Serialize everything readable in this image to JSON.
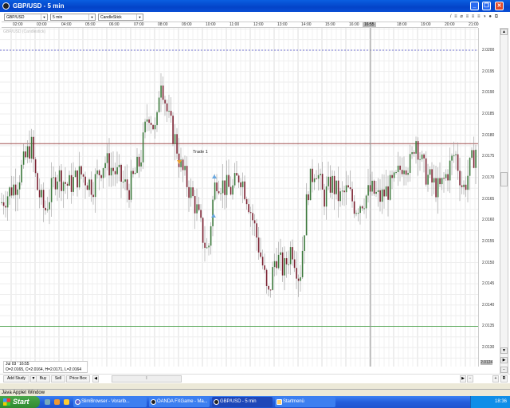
{
  "window": {
    "title": "GBP/USD - 5 min"
  },
  "toolbar": {
    "instrument": "GBP/USD",
    "interval": "5 min",
    "chart_type": "CandleStick",
    "tools": "/ ≡ ⌀  ≡ ≡ ≡ ◑ ● ⧉"
  },
  "time_axis": {
    "labels": [
      "02:00",
      "03:00",
      "04:00",
      "05:00",
      "06:00",
      "07:00",
      "08:00",
      "09:00",
      "10:00",
      "11:00",
      "12:00",
      "13:00",
      "14:00",
      "15:00",
      "16:00",
      "18:00",
      "19:00",
      "20:00",
      "21:00"
    ],
    "cursor_time": "16:55"
  },
  "chart_legend": "GBP/USD (Candlestick)",
  "price_axis": {
    "labels": [
      "2.0200",
      "2.0195",
      "2.0190",
      "2.0185",
      "2.0180",
      "2.0175",
      "2.0170",
      "2.0165",
      "2.0160",
      "2.0155",
      "2.0150",
      "2.0145",
      "2.0140",
      "2.0135",
      "2.0130"
    ],
    "current": "2.0124"
  },
  "annotations": {
    "trade_label": "Trade 1",
    "trade_line_price": 2.0178,
    "support_line_price": 2.0135,
    "dotted_line_price": 2.02
  },
  "chart_data": {
    "type": "candlestick",
    "ylim": [
      2.0121,
      2.0206
    ],
    "close_path": [
      [
        0,
        2.0164
      ],
      [
        20,
        2.0169
      ],
      [
        38,
        2.0178
      ],
      [
        45,
        2.0168
      ],
      [
        55,
        2.0162
      ],
      [
        70,
        2.0171
      ],
      [
        85,
        2.0168
      ],
      [
        100,
        2.0171
      ],
      [
        115,
        2.0168
      ],
      [
        130,
        2.0174
      ],
      [
        145,
        2.0171
      ],
      [
        160,
        2.0167
      ],
      [
        175,
        2.0174
      ],
      [
        185,
        2.0186
      ],
      [
        195,
        2.018
      ],
      [
        200,
        2.0195
      ],
      [
        210,
        2.0184
      ],
      [
        220,
        2.0178
      ],
      [
        225,
        2.0173
      ],
      [
        235,
        2.0168
      ],
      [
        245,
        2.0163
      ],
      [
        255,
        2.0155
      ],
      [
        260,
        2.0152
      ],
      [
        265,
        2.0163
      ],
      [
        270,
        2.017
      ],
      [
        280,
        2.0168
      ],
      [
        290,
        2.0167
      ],
      [
        300,
        2.0171
      ],
      [
        310,
        2.0165
      ],
      [
        320,
        2.0157
      ],
      [
        330,
        2.0148
      ],
      [
        335,
        2.0141
      ],
      [
        345,
        2.0152
      ],
      [
        355,
        2.0148
      ],
      [
        365,
        2.0154
      ],
      [
        375,
        2.0146
      ],
      [
        385,
        2.0167
      ],
      [
        395,
        2.0173
      ],
      [
        405,
        2.0165
      ],
      [
        415,
        2.0169
      ],
      [
        425,
        2.0165
      ],
      [
        435,
        2.0167
      ],
      [
        445,
        2.0163
      ],
      [
        455,
        2.0165
      ],
      [
        465,
        2.0167
      ],
      [
        475,
        2.0165
      ],
      [
        485,
        2.0167
      ],
      [
        495,
        2.0169
      ],
      [
        505,
        2.0174
      ],
      [
        515,
        2.0173
      ],
      [
        520,
        2.018
      ],
      [
        530,
        2.0172
      ],
      [
        540,
        2.0169
      ],
      [
        550,
        2.0167
      ],
      [
        560,
        2.0171
      ],
      [
        570,
        2.0176
      ],
      [
        580,
        2.0167
      ],
      [
        590,
        2.0173
      ],
      [
        598,
        2.0178
      ]
    ]
  },
  "info": {
    "date": "Jul 03 ' 16:55",
    "ohlc": "O=2.0165, C=2.0164, H=2.0171, L=2.0164"
  },
  "bottom_toolbar": {
    "add_study": "Add Study",
    "buy": "Buy",
    "sell": "Sell",
    "price_box": "Price Box",
    "reset": "R"
  },
  "status_bar": "Java Applet Window",
  "taskbar": {
    "start": "Start",
    "tasks": [
      "SlimBrowser - Vorarlb...",
      "OANDA FXGame - Ma...",
      "GBP/USD - 5 min",
      "Startmenü"
    ],
    "clock": "18:36"
  },
  "colors": {
    "up": "#3d7a3d",
    "down": "#7a2030",
    "trade_line": "#a05050",
    "support_line": "#5aa85a",
    "dotted_line": "#7070d0"
  }
}
